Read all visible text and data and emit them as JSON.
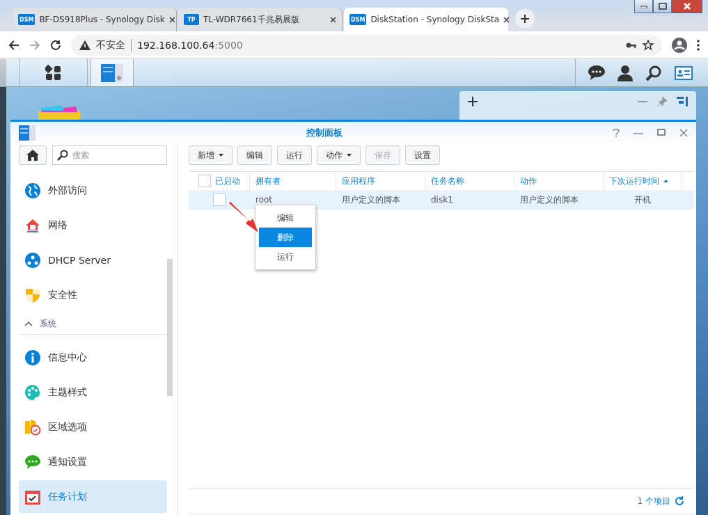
{
  "browser": {
    "tabs": [
      {
        "favicon": "DSM",
        "title": "BF-DS918Plus - Synology Disk",
        "selected": false
      },
      {
        "favicon": "TP",
        "title": "TL-WDR7661千兆易展版",
        "selected": false
      },
      {
        "favicon": "DSM",
        "title": "DiskStation - Synology DiskSta",
        "selected": true
      }
    ],
    "security": "不安全",
    "host": "192.168.100.64",
    "port": ":5000"
  },
  "window": {
    "title": "控制面板"
  },
  "sidebar": {
    "search": {
      "placeholder": "搜索"
    },
    "items": [
      {
        "kind": "item",
        "label": "外部访问",
        "selected": false
      },
      {
        "kind": "item",
        "label": "网络",
        "selected": false
      },
      {
        "kind": "item",
        "label": "DHCP Server",
        "selected": false
      },
      {
        "kind": "item",
        "label": "安全性",
        "selected": false
      },
      {
        "kind": "section",
        "label": "系统",
        "expanded": true
      },
      {
        "kind": "item",
        "label": "信息中心",
        "selected": false
      },
      {
        "kind": "item",
        "label": "主题样式",
        "selected": false
      },
      {
        "kind": "item",
        "label": "区域选项",
        "selected": false
      },
      {
        "kind": "item",
        "label": "通知设置",
        "selected": false
      },
      {
        "kind": "item",
        "label": "任务计划",
        "selected": true
      }
    ]
  },
  "toolbar": [
    {
      "label": "新增",
      "dropdown": true,
      "disabled": false
    },
    {
      "label": "编辑",
      "dropdown": false,
      "disabled": false
    },
    {
      "label": "运行",
      "dropdown": false,
      "disabled": false
    },
    {
      "label": "动作",
      "dropdown": true,
      "disabled": false
    },
    {
      "label": "保存",
      "dropdown": false,
      "disabled": true
    },
    {
      "label": "设置",
      "dropdown": false,
      "disabled": false
    }
  ],
  "table": {
    "columns": [
      {
        "label": "已启动",
        "sorted": false
      },
      {
        "label": "拥有者",
        "sorted": false
      },
      {
        "label": "应用程序",
        "sorted": false
      },
      {
        "label": "任务名称",
        "sorted": false
      },
      {
        "label": "动作",
        "sorted": false
      },
      {
        "label": "下次运行时间",
        "sorted": true
      }
    ],
    "rows": [
      {
        "enabled": false,
        "selected": true,
        "cells": [
          "",
          "root",
          "用户定义的脚本",
          "disk1",
          "用户定义的脚本",
          "开机"
        ]
      }
    ]
  },
  "context_menu": [
    {
      "label": "编辑",
      "selected": false
    },
    {
      "label": "删除",
      "selected": true
    },
    {
      "label": "运行",
      "selected": false
    }
  ],
  "footer": {
    "count": "1 个项目"
  }
}
